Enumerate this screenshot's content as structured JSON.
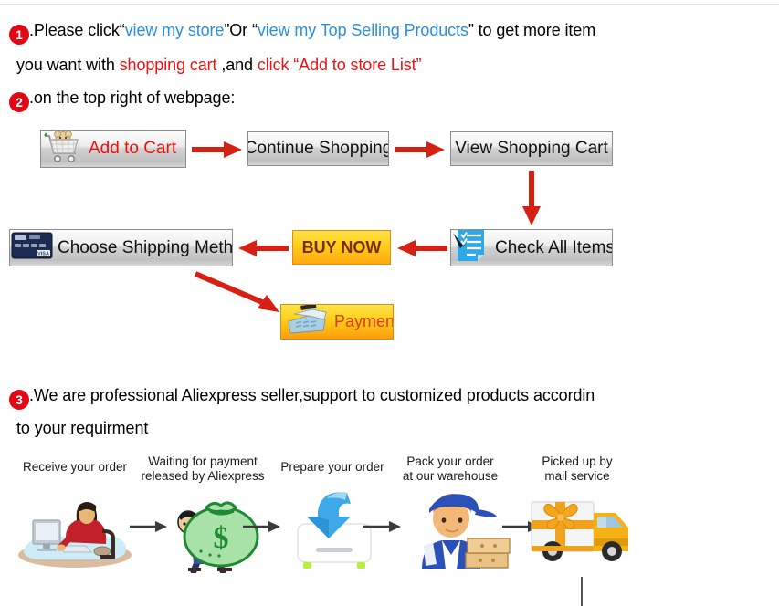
{
  "instructions": [
    {
      "number": "1",
      "line1_a": ".Please click“",
      "line1_link1": "view my store",
      "line1_b": "”Or “",
      "line1_link2": "view my Top Selling Products",
      "line1_c": "” to get more item",
      "line2_a": "you want with ",
      "line2_red1": "shopping cart",
      "line2_b": " ,and ",
      "line2_red2": "click “Add to store List”"
    },
    {
      "number": "2",
      "text": ".on the top right of webpage:"
    },
    {
      "number": "3",
      "line1": ".We are professional Aliexpress seller,support to customized products accordin",
      "line2": "to your requirment"
    }
  ],
  "flow": {
    "buttons": [
      {
        "id": "add-to-cart",
        "label": "Add to Cart",
        "icon": "shopping-cart-icon"
      },
      {
        "id": "continue",
        "label": "Continue Shopping",
        "icon": "none"
      },
      {
        "id": "view-cart",
        "label": "View Shopping Cart",
        "icon": "none"
      },
      {
        "id": "check-items",
        "label": "Check All Items",
        "icon": "checklist-icon"
      },
      {
        "id": "buy-now",
        "label": "BUY NOW",
        "icon": "none"
      },
      {
        "id": "shipping",
        "label": "Choose Shipping Method",
        "icon": "credit-card-icon"
      },
      {
        "id": "payment",
        "label": "Payment",
        "icon": "cash-register-icon"
      }
    ],
    "arrow_color": "#d81f13"
  },
  "shipping_process": {
    "steps": [
      {
        "label": "Receive your order",
        "art": "person-at-computer-art"
      },
      {
        "label": "Waiting for payment\nreleased by Aliexpress",
        "art": "money-bag-art"
      },
      {
        "label": "Prepare your order",
        "art": "download-box-art"
      },
      {
        "label": "Pack your order\nat our warehouse",
        "art": "worker-packing-art"
      },
      {
        "label": "Picked up by\nmail service",
        "art": "delivery-truck-art"
      }
    ],
    "arrow_color": "#3a3a3a"
  },
  "colors": {
    "badge_red": "#e30613",
    "link_blue": "#2a8fe0",
    "highlight_red": "#ee1111",
    "buy_now_orange": "#ffd21e"
  }
}
